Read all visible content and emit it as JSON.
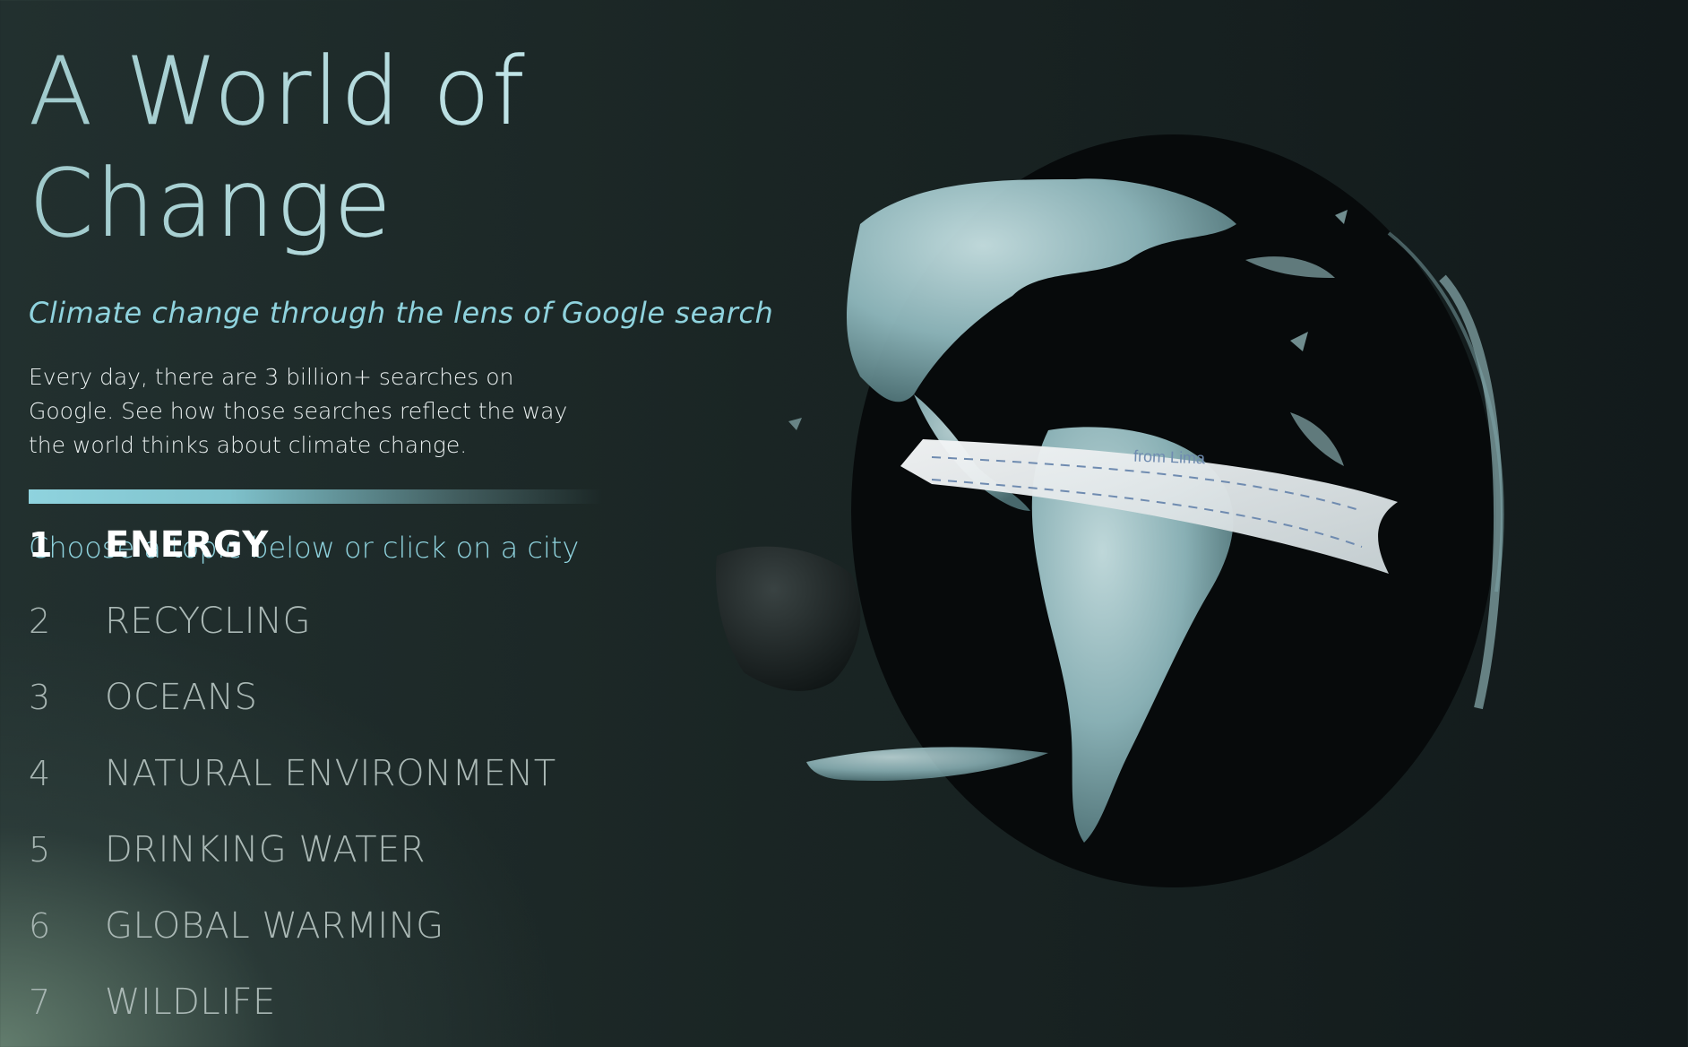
{
  "header": {
    "title": "A World of Change",
    "subtitle": "Climate change through the lens of Google search"
  },
  "intro": {
    "description": "Every day, there are 3 billion+ searches on Google. See how those searches reflect the way the world thinks about climate change.",
    "prompt": "Choose a topic below or click on a city"
  },
  "topics": [
    {
      "number": "1",
      "label": "ENERGY",
      "active": true
    },
    {
      "number": "2",
      "label": "RECYCLING"
    },
    {
      "number": "3",
      "label": "OCEANS"
    },
    {
      "number": "4",
      "label": "NATURAL ENVIRONMENT"
    },
    {
      "number": "5",
      "label": "DRINKING WATER"
    },
    {
      "number": "6",
      "label": "GLOBAL WARMING"
    },
    {
      "number": "7",
      "label": "WILDLIFE"
    }
  ],
  "globe": {
    "banner_label": "from Lima",
    "land_color": "#9cc4c8",
    "ocean_color": "#070a0b",
    "banner_color": "#e9eef0"
  }
}
